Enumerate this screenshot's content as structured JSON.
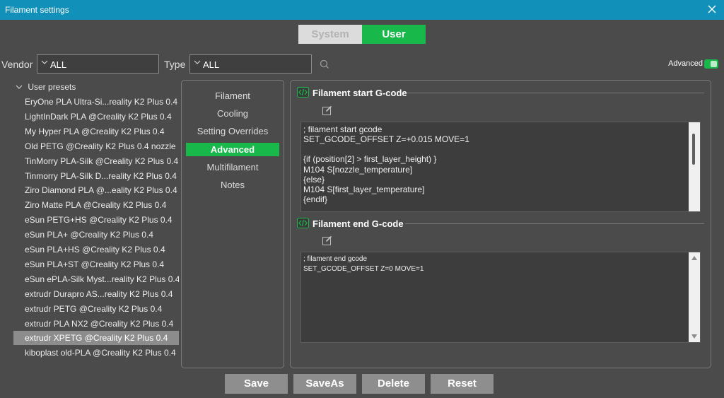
{
  "window": {
    "title": "Filament settings"
  },
  "mode_switch": {
    "system_label": "System",
    "user_label": "User"
  },
  "filters": {
    "vendor_label": "Vendor",
    "vendor_value": "ALL",
    "type_label": "Type",
    "type_value": "ALL"
  },
  "advanced_toggle": {
    "label": "Advanced",
    "on": true
  },
  "presets": {
    "group_label": "User presets",
    "items": [
      "EryOne PLA Ultra-Si...reality K2 Plus 0.4",
      "LightInDark PLA @Creality K2 Plus 0.4",
      "My Hyper PLA @Creality K2 Plus 0.4",
      "Old PETG @Creality K2 Plus 0.4 nozzle",
      "TinMorry PLA-Silk @Creality K2 Plus 0.4",
      "Tinmorry PLA-Silk D...reality K2 Plus 0.4",
      "Ziro Diamond PLA @...eality K2 Plus 0.4",
      "Ziro Matte PLA @Creality K2 Plus 0.4",
      "eSun PETG+HS @Creality K2 Plus 0.4",
      "eSun PLA+ @Creality K2 Plus 0.4",
      "eSun PLA+HS @Creality K2 Plus 0.4",
      "eSun PLA+ST @Creality K2 Plus 0.4",
      "eSun ePLA-Silk Myst...reality K2 Plus 0.4",
      "extrudr Durapro AS...reality K2 Plus 0.4",
      "extrudr PETG @Creality K2 Plus 0.4",
      "extrudr PLA NX2 @Creality K2 Plus 0.4",
      "extrudr XPETG @Creality K2 Plus 0.4",
      "kiboplast old-PLA @Creality K2 Plus 0.4"
    ],
    "selected_index": 16
  },
  "tabs": [
    "Filament",
    "Cooling",
    "Setting Overrides",
    "Advanced",
    "Multifilament",
    "Notes"
  ],
  "active_tab": "Advanced",
  "start_gcode": {
    "title": "Filament start G-code",
    "lines": [
      "; filament start gcode",
      "SET_GCODE_OFFSET Z=+0.015 MOVE=1",
      "",
      "{if (position[2] > first_layer_height) }",
      "M104 S[nozzle_temperature]",
      "{else}",
      "M104 S[first_layer_temperature]",
      "{endif}"
    ]
  },
  "end_gcode": {
    "title": "Filament end G-code",
    "lines": [
      "; filament end gcode",
      "SET_GCODE_OFFSET Z=0 MOVE=1"
    ]
  },
  "buttons": {
    "save": "Save",
    "save_as": "SaveAs",
    "delete": "Delete",
    "reset": "Reset"
  },
  "colors": {
    "accent": "#19b84a",
    "titlebar": "#1190ba",
    "background": "#4b4b4b"
  }
}
